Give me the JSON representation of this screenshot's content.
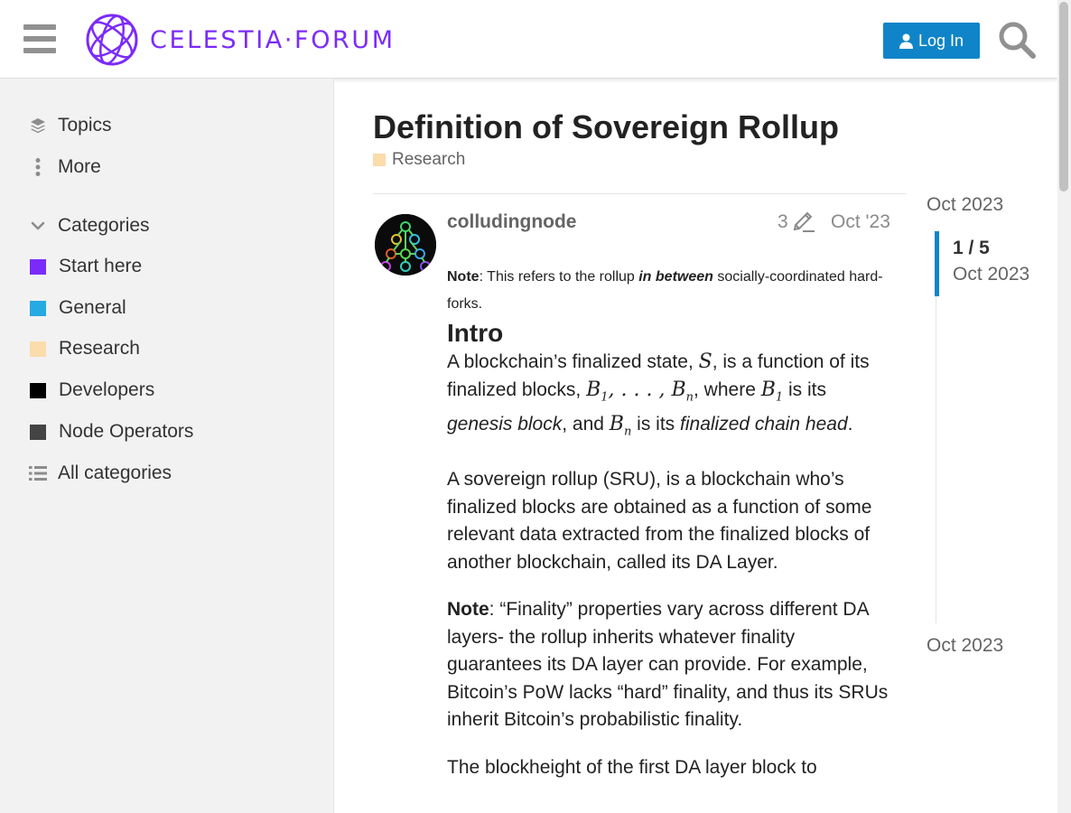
{
  "header": {
    "logo_text": "CELESTIA·FORUM",
    "login_label": "Log In",
    "brand_color": "#7b2bf9",
    "login_color": "#0f84c8"
  },
  "sidebar": {
    "nav": [
      {
        "label": "Topics",
        "icon": "layers-icon"
      },
      {
        "label": "More",
        "icon": "vertical-ellipsis-icon"
      }
    ],
    "categories_heading": "Categories",
    "categories": [
      {
        "label": "Start here",
        "color": "#7b2bf9"
      },
      {
        "label": "General",
        "color": "#25aae1"
      },
      {
        "label": "Research",
        "color": "#fbdcab"
      },
      {
        "label": "Developers",
        "color": "#000000"
      },
      {
        "label": "Node Operators",
        "color": "#444444"
      }
    ],
    "all_categories": "All categories"
  },
  "topic": {
    "title": "Definition of Sovereign Rollup",
    "category": "Research",
    "category_color": "#fbdcab"
  },
  "post": {
    "username": "colludingnode",
    "edit_count": "3",
    "date": "Oct '23",
    "note_label": "Note",
    "note_text_1": ": This refers to the rollup ",
    "note_em": "in between",
    "note_text_2": " socially-coordinated hard-forks.",
    "intro_heading": "Intro",
    "p1_a": "A blockchain’s finalized state, ",
    "p1_math_s": "S",
    "p1_b": ", is a function of its finalized blocks, ",
    "p1_math_b": "B",
    "p1_math_sub1": "1",
    "p1_math_dots": ", . . . , B",
    "p1_math_subn": "n",
    "p1_c": ", where ",
    "p1_math_b1": "B",
    "p1_math_b1_sub": "1",
    "p1_d": " is its ",
    "p1_em1": "genesis block",
    "p1_e": ", and ",
    "p1_math_bn": "B",
    "p1_math_bn_sub": "n",
    "p1_f": " is its ",
    "p1_em2": "finalized chain head",
    "p1_g": ".",
    "p2": "A sovereign rollup (SRU), is a blockchain who’s finalized blocks are obtained as a function of some relevant data extracted from the finalized blocks of another blockchain, called its DA Layer.",
    "p3_label": "Note",
    "p3": ": “Finality” properties vary across different DA layers- the rollup inherits whatever finality guarantees its DA layer can provide. For example, Bitcoin’s PoW lacks “hard” finality, and thus its SRUs inherit Bitcoin’s probabilistic finality.",
    "p4": "The blockheight of the first DA layer block to"
  },
  "timeline": {
    "top_date": "Oct 2023",
    "position": "1 / 5",
    "current_date": "Oct 2023",
    "bottom_date": "Oct 2023"
  }
}
